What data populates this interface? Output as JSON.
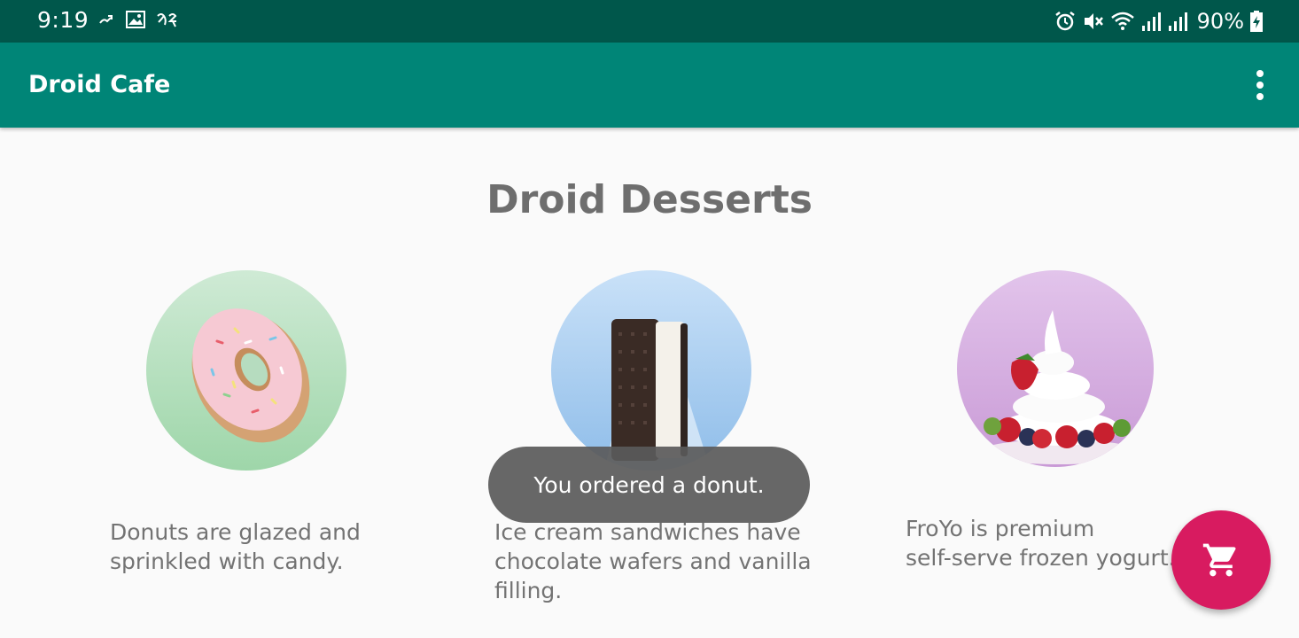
{
  "status_bar": {
    "time": "9:19",
    "left_icons": [
      "notification-icon",
      "image-icon",
      "language-icon"
    ],
    "right_icons": [
      "alarm-icon",
      "mute-icon",
      "wifi-icon",
      "signal-icon",
      "signal-icon",
      "battery-charging-icon"
    ],
    "battery_percent": "90%"
  },
  "app_bar": {
    "title": "Droid Cafe",
    "menu_icon": "more-vert-icon"
  },
  "main": {
    "heading": "Droid Desserts",
    "desserts": [
      {
        "name": "donut",
        "description_lines": [
          "Donuts are glazed and",
          "sprinkled with candy."
        ]
      },
      {
        "name": "ice-cream-sandwich",
        "description_lines": [
          "Ice cream sandwiches have",
          "chocolate wafers and vanilla",
          "filling."
        ]
      },
      {
        "name": "froyo",
        "description_lines": [
          "FroYo is premium",
          "self-serve frozen yogurt."
        ]
      }
    ]
  },
  "toast": {
    "message": "You ordered a donut."
  },
  "fab": {
    "icon": "shopping-cart-icon"
  },
  "colors": {
    "status_bar": "#00574b",
    "app_bar": "#008577",
    "fab": "#d81b60",
    "text": "#737373"
  }
}
